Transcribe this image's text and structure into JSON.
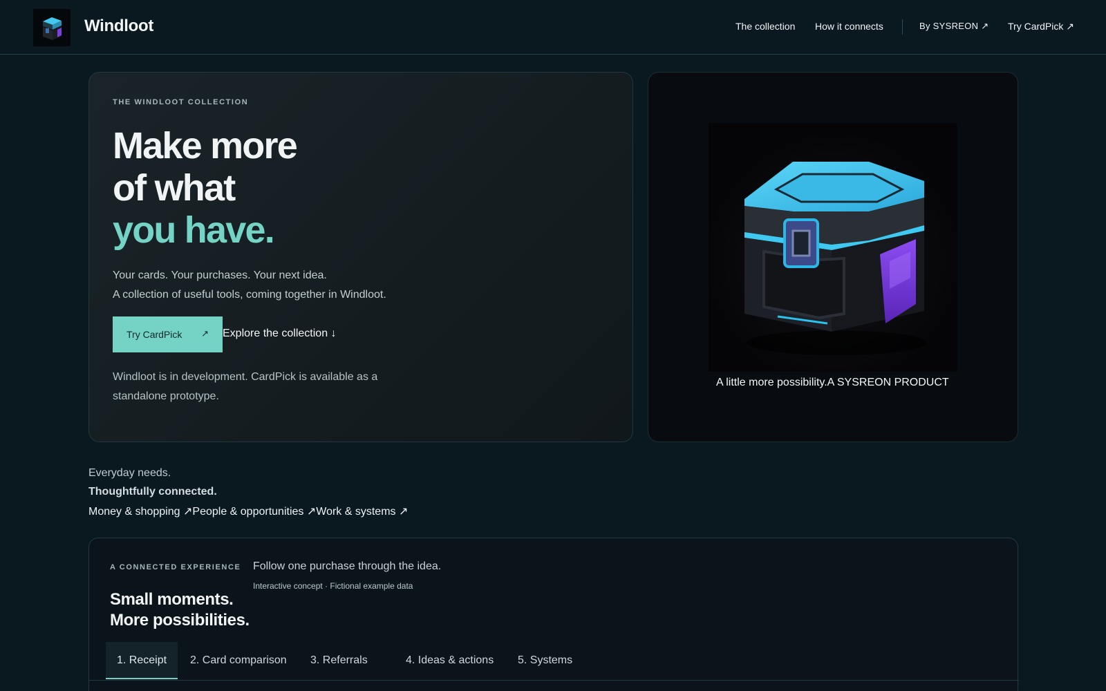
{
  "header": {
    "brand": "Windloot",
    "nav": [
      "The collection",
      "How it connects"
    ],
    "by_link": "By SYSREON ↗",
    "try_link": "Try CardPick ↗"
  },
  "hero": {
    "eyebrow": "THE WINDLOOT COLLECTION",
    "headline_line1": "Make more",
    "headline_line2": "of what",
    "headline_accent": "you have.",
    "lead_line1": "Your cards. Your purchases. Your next idea.",
    "lead_line2": "A collection of useful tools, coming together in Windloot.",
    "cta_label": "Try CardPick",
    "cta_arrow": "↗",
    "explore_label": "Explore the collection ↓",
    "dev_note": "Windloot is in development. CardPick is available as a standalone prototype."
  },
  "showcase": {
    "caption": "A little more possibility.A SYSREON PRODUCT"
  },
  "everyday": {
    "line1": "Everyday needs.",
    "line2": "Thoughtfully connected.",
    "links": [
      "Money & shopping ↗",
      "People & opportunities ↗",
      "Work & systems ↗"
    ]
  },
  "connected": {
    "eyebrow": "A CONNECTED EXPERIENCE",
    "title_line1": "Small moments.",
    "title_line2": "More possibilities.",
    "follow": "Follow one purchase through the idea.",
    "note": "Interactive concept · Fictional example data",
    "tabs": [
      "1. Receipt",
      "2. Card comparison",
      "3. Referrals",
      "4. Ideas & actions",
      "5. Systems"
    ],
    "active_tab": 0
  },
  "colors": {
    "accent": "#74d3c5",
    "background": "#0a1820",
    "card": "#1a2428",
    "chest_cyan": "#3fc3ee",
    "chest_purple": "#7a3de0"
  }
}
